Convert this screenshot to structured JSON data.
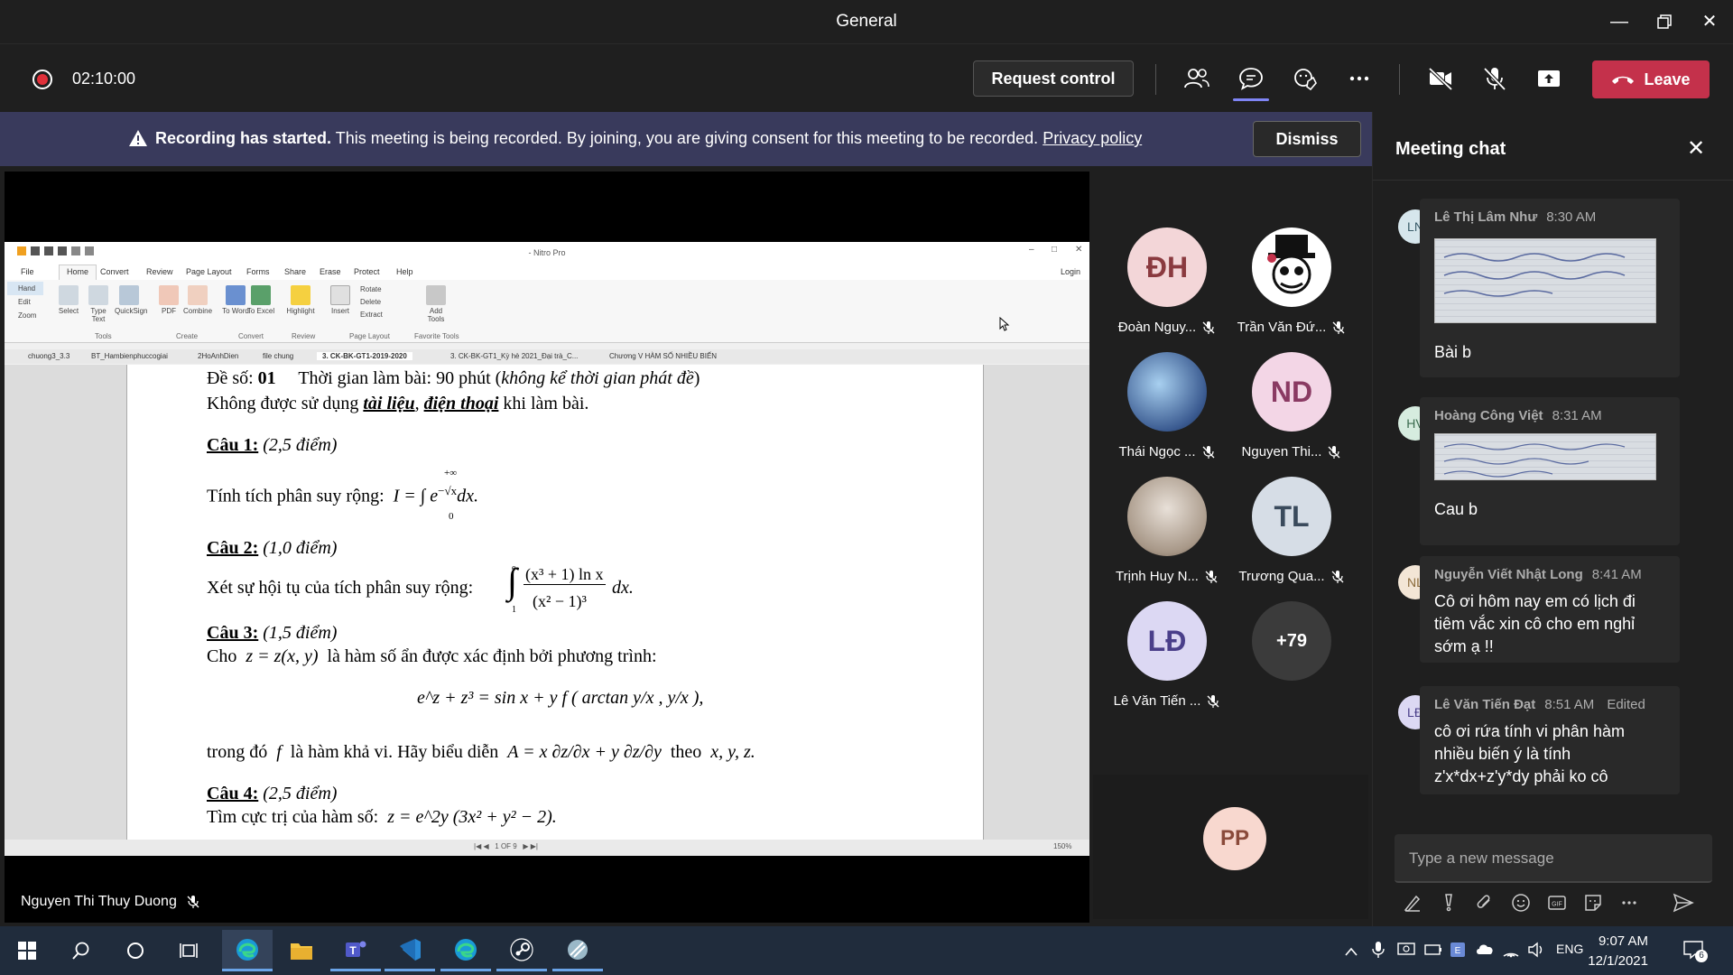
{
  "window": {
    "title": "General"
  },
  "meeting": {
    "timer": "02:10:00",
    "request_control_label": "Request control",
    "leave_label": "Leave"
  },
  "banner": {
    "bold": "Recording has started.",
    "text": "This meeting is being recorded. By joining, you are giving consent for this meeting to be recorded.",
    "link": "Privacy policy",
    "dismiss_label": "Dismiss"
  },
  "presenter": {
    "name": "Nguyen Thi Thuy Duong"
  },
  "nitro": {
    "title": "- Nitro Pro",
    "menu": [
      "File",
      "Home",
      "Convert",
      "Review",
      "Page Layout",
      "Forms",
      "Share",
      "Erase",
      "Protect",
      "Help"
    ],
    "login": "Login",
    "ribbon_left": [
      "Hand",
      "Edit",
      "Zoom"
    ],
    "ribbon_items": [
      "Select",
      "Type Text",
      "QuickSign",
      "PDF",
      "Combine",
      "To Word",
      "To Excel",
      "Highlight",
      "Insert",
      "Rotate",
      "Delete",
      "Extract",
      "Add Tools"
    ],
    "ribbon_groups": [
      "Tools",
      "Create",
      "Convert",
      "Review",
      "Page Layout",
      "Favorite Tools"
    ],
    "tabs": [
      "chuong3_3.3",
      "BT_Hambienphuccogiai",
      "2HoAnhDien",
      "file chung",
      "3. CK-BK-GT1-2019-2020",
      "3. CK-BK-GT1_Kỳ hè 2021_Đại trà_C...",
      "Chương V HÀM SỐ NHIỀU BIẾN"
    ],
    "page_info": "1 OF 9",
    "zoom": "150%"
  },
  "document": {
    "line1_a": "Đề số:",
    "line1_b": "01",
    "line1_c": "Thời gian làm bài: 90 phút (",
    "line1_d": "không kể thời gian phát đề",
    "line1_e": ")",
    "line2_a": "Không được sử dụng",
    "line2_b": "tài liệu",
    "line2_c": ",",
    "line2_d": "điện thoại",
    "line2_e": "khi làm bài.",
    "q1_title": "Câu 1:",
    "q1_points": "(2,5 điểm)",
    "q1_text": "Tính tích phân suy rộng:",
    "q1_formula": "I = ∫ e",
    "q1_exp": "−√x",
    "q1_dx": "dx.",
    "q1_upper": "+∞",
    "q1_lower": "0",
    "q2_title": "Câu 2:",
    "q2_points": "(1,0 điểm)",
    "q2_text": "Xét sự hội tụ của tích phân suy rộng:",
    "q2_num": "(x³ + 1) ln x",
    "q2_den": "(x² − 1)³",
    "q2_dx": "dx.",
    "q2_upper": "e",
    "q2_lower": "1",
    "q3_title": "Câu 3:",
    "q3_points": "(1,5 điểm)",
    "q3_text_a": "Cho",
    "q3_text_b": "z = z(x, y)",
    "q3_text_c": "là hàm số ẩn được xác định bởi phương trình:",
    "q3_eq": "e^z + z³ = sin x + y f ( arctan y/x , y/x ),",
    "q3_text2_a": "trong đó",
    "q3_text2_b": "f",
    "q3_text2_c": "là hàm khả vi. Hãy biểu diễn",
    "q3_text2_d": "A = x ∂z/∂x + y ∂z/∂y",
    "q3_text2_e": "theo",
    "q3_text2_f": "x, y, z.",
    "q4_title": "Câu 4:",
    "q4_points": "(2,5 điểm)",
    "q4_text": "Tìm cực trị của hàm số:",
    "q4_formula": "z = e^2y (3x² + y² − 2)."
  },
  "participants": [
    {
      "initials": "ĐH",
      "name": "Đoàn Nguy...",
      "color": "#f3d6d8",
      "text_color": "#8a3a3f"
    },
    {
      "initials": "",
      "name": "Trần Văn Đứ...",
      "color": "#ffffff",
      "text_color": "#000000"
    },
    {
      "initials": "",
      "name": "Thái Ngọc ...",
      "color": "#5a7aa8",
      "text_color": "#ffffff"
    },
    {
      "initials": "ND",
      "name": "Nguyen Thi...",
      "color": "#f3d6e6",
      "text_color": "#8a3a63"
    },
    {
      "initials": "",
      "name": "Trịnh Huy N...",
      "color": "#c8bfb5",
      "text_color": "#ffffff"
    },
    {
      "initials": "TL",
      "name": "Trương Qua...",
      "color": "#d6dde6",
      "text_color": "#3a4a5c"
    },
    {
      "initials": "LĐ",
      "name": "Lê Văn Tiến ...",
      "color": "#dcd8f3",
      "text_color": "#4a3f8a"
    },
    {
      "initials": "+79",
      "name": "",
      "color": "#3b3b3b",
      "text_color": "#ffffff"
    }
  ],
  "self_tile": {
    "initials": "PP",
    "color": "#f8d8cf",
    "text_color": "#8a4a3a"
  },
  "chat": {
    "title": "Meeting chat",
    "messages": [
      {
        "initials": "LN",
        "name": "Lê Thị Lâm Như",
        "time": "8:30 AM",
        "text": "Bài b",
        "edited": "",
        "av_color": "#d6e6ec",
        "av_text": "#3a5c6a"
      },
      {
        "initials": "HV",
        "name": "Hoàng Công Việt",
        "time": "8:31 AM",
        "text": "Cau b",
        "edited": "",
        "av_color": "#d6ecdf",
        "av_text": "#3a6a4e"
      },
      {
        "initials": "NL",
        "name": "Nguyễn Viết Nhật Long",
        "time": "8:41 AM",
        "text": "Cô ơi hôm nay em có lịch đi tiêm vắc xin cô cho em nghỉ sớm ạ !!",
        "edited": "",
        "av_color": "#f3e6d6",
        "av_text": "#8a6a3a"
      },
      {
        "initials": "LĐ",
        "name": "Lê Văn Tiến Đạt",
        "time": "8:51 AM",
        "text": "cô ơi rứa tính vi phân hàm nhiều biến ý là tính z'x*dx+z'y*dy phải ko cô",
        "edited": "Edited",
        "av_color": "#dcd8f3",
        "av_text": "#4a3f8a"
      }
    ],
    "compose_placeholder": "Type a new message"
  },
  "taskbar": {
    "time": "9:07 AM",
    "date": "12/1/2021",
    "lang": "ENG",
    "notifications": "6"
  }
}
